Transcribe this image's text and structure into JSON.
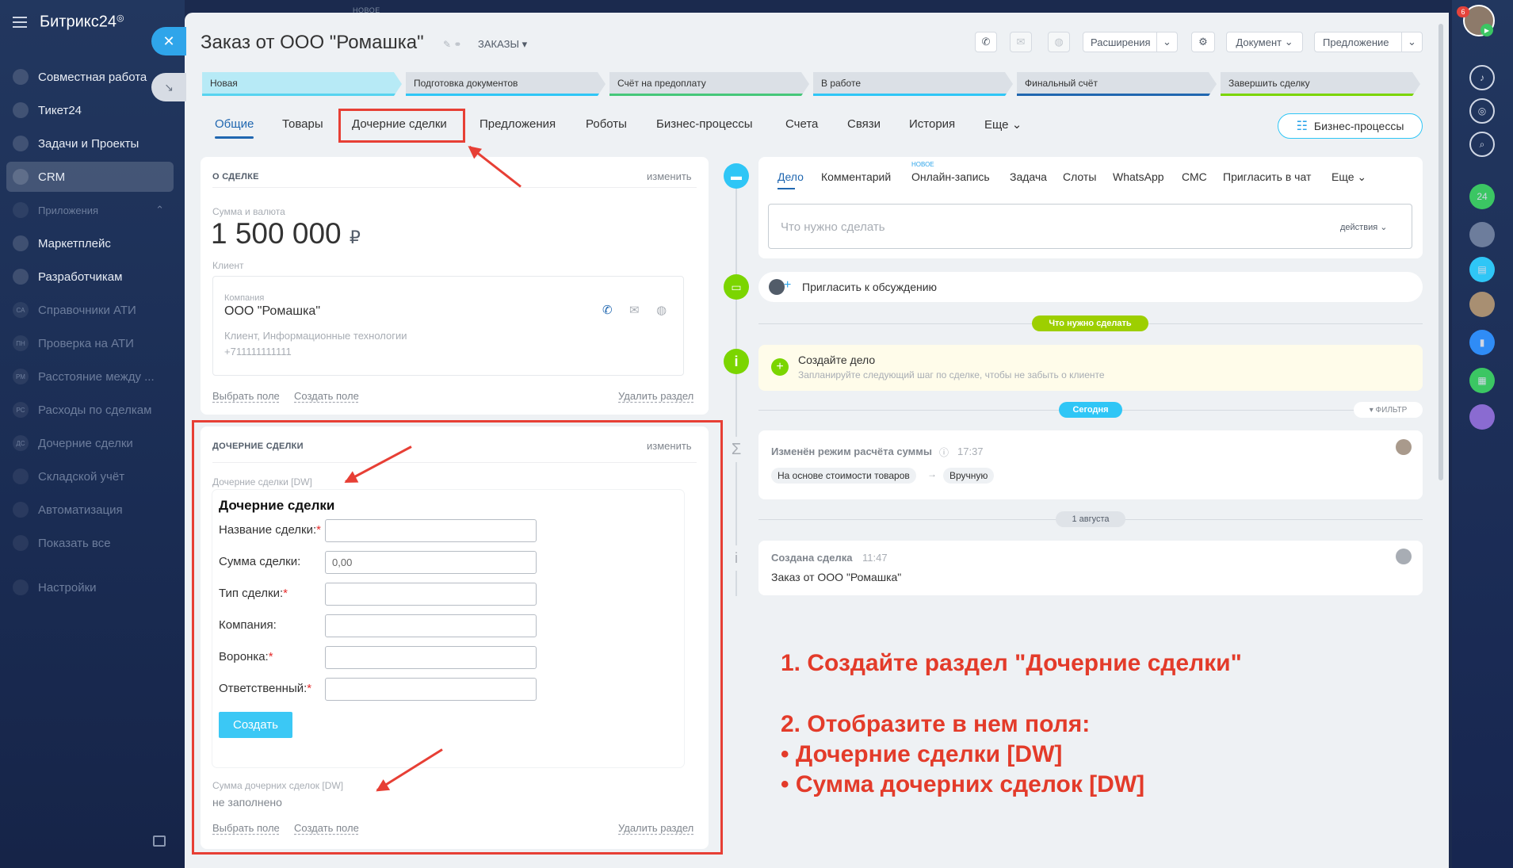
{
  "sidebar": {
    "logo": "Битрикс24",
    "items": [
      {
        "label": "Совместная работа",
        "icon": "chat-icon"
      },
      {
        "label": "Тикет24",
        "icon": "hand-icon"
      },
      {
        "label": "Задачи и Проекты",
        "icon": "checkbox-icon"
      },
      {
        "label": "CRM",
        "icon": "filter-icon"
      },
      {
        "label": "Приложения",
        "icon": "cube-icon"
      },
      {
        "label": "Маркетплейс",
        "icon": "market-icon"
      },
      {
        "label": "Разработчикам",
        "icon": "code-icon"
      },
      {
        "label": "Справочники АТИ",
        "icon": "badge-ca",
        "badge": "СА"
      },
      {
        "label": "Проверка на АТИ",
        "icon": "badge-pn",
        "badge": "ПН"
      },
      {
        "label": "Расстояние между ...",
        "icon": "badge-rm",
        "badge": "РМ"
      },
      {
        "label": "Расходы по сделкам",
        "icon": "badge-rs",
        "badge": "РС"
      },
      {
        "label": "Дочерние сделки",
        "icon": "badge-ds",
        "badge": "ДС"
      },
      {
        "label": "Складской учёт",
        "icon": "box-icon"
      },
      {
        "label": "Автоматизация",
        "icon": "robot-icon"
      },
      {
        "label": "Показать все",
        "icon": "more-icon"
      },
      {
        "label": "Настройки",
        "icon": "gear-icon"
      }
    ]
  },
  "panel": {
    "new_tag": "НОВОЕ"
  },
  "header": {
    "title": "Заказ от ООО \"Ромашка\"",
    "pipeline": "ЗАКАЗЫ",
    "buttons": {
      "extensions": "Расширения",
      "document": "Документ",
      "offer": "Предложение"
    },
    "notification_count": "6"
  },
  "stages": [
    {
      "label": "Новая",
      "color": "#57d4f0",
      "bg": "#b7eaf6"
    },
    {
      "label": "Подготовка документов",
      "color": "#2fc6f6",
      "bg": "#dbe0e6"
    },
    {
      "label": "Счёт на предоплату",
      "color": "#46c77a",
      "bg": "#dbe0e6"
    },
    {
      "label": "В работе",
      "color": "#2fc6f6",
      "bg": "#dbe0e6"
    },
    {
      "label": "Финальный счёт",
      "color": "#2067b0",
      "bg": "#dbe0e6"
    },
    {
      "label": "Завершить сделку",
      "color": "#7bd500",
      "bg": "#dbe0e6"
    }
  ],
  "tabs": [
    "Общие",
    "Товары",
    "Дочерние сделки",
    "Предложения",
    "Роботы",
    "Бизнес-процессы",
    "Счета",
    "Связи",
    "История",
    "Еще"
  ],
  "bp_button": "Бизнес-процессы",
  "about": {
    "caption": "О СДЕЛКЕ",
    "edit": "изменить",
    "amount_label": "Сумма и валюта",
    "amount": "1 500 000",
    "currency": "₽",
    "client_label": "Клиент",
    "company_label": "Компания",
    "company": "ООО \"Ромашка\"",
    "company_meta": "Клиент, Информационные технологии",
    "phone": "+711111111111",
    "choose_field": "Выбрать поле",
    "create_field": "Создать поле",
    "delete_section": "Удалить раздел"
  },
  "child_deals": {
    "caption": "ДОЧЕРНИЕ СДЕЛКИ",
    "edit": "изменить",
    "field_label": "Дочерние сделки [DW]",
    "form_title": "Дочерние сделки",
    "fields": [
      {
        "label": "Название сделки:",
        "required": true,
        "value": ""
      },
      {
        "label": "Сумма сделки:",
        "required": false,
        "value": "0,00"
      },
      {
        "label": "Тип сделки:",
        "required": true,
        "value": ""
      },
      {
        "label": "Компания:",
        "required": false,
        "value": ""
      },
      {
        "label": "Воронка:",
        "required": true,
        "value": ""
      },
      {
        "label": "Ответственный:",
        "required": true,
        "value": ""
      }
    ],
    "create_button": "Создать",
    "sum_label": "Сумма дочерних сделок [DW]",
    "sum_value": "не заполнено",
    "choose_field": "Выбрать поле",
    "create_field": "Создать поле",
    "delete_section": "Удалить раздел"
  },
  "timeline": {
    "tabs": [
      "Дело",
      "Комментарий",
      "Онлайн-запись",
      "Задача",
      "Слоты",
      "WhatsApp",
      "СМС",
      "Пригласить в чат",
      "Еще"
    ],
    "new_badge": "НОВОЕ",
    "todo_placeholder": "Что нужно сделать",
    "actions": "действия",
    "invite": "Пригласить к обсуждению",
    "todo_pill": "Что нужно сделать",
    "create_task_title": "Создайте дело",
    "create_task_sub": "Запланируйте следующий шаг по сделке, чтобы не забыть о клиенте",
    "today_pill": "Сегодня",
    "filter": "ФИЛЬТР",
    "event1_title": "Изменён режим расчёта суммы",
    "event1_time": "17:37",
    "event1_from": "На основе стоимости товаров",
    "event1_to": "Вручную",
    "date_pill": "1 августа",
    "event2_title": "Создана сделка",
    "event2_time": "11:47",
    "event2_body": "Заказ от ООО \"Ромашка\""
  },
  "annotation": {
    "line1": "1. Создайте раздел \"Дочерние сделки\"",
    "line2": "2. Отобразите в нем поля:",
    "line3": "• Дочерние сделки [DW]",
    "line4": "• Сумма дочерних сделок [DW]"
  }
}
